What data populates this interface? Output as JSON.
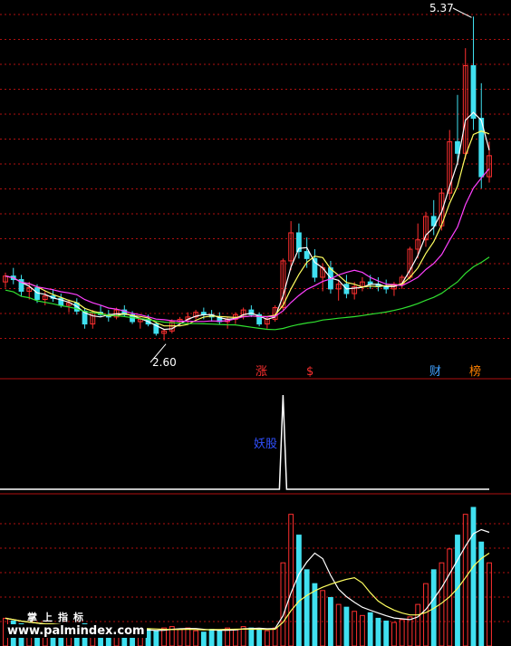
{
  "colors": {
    "background": "#000000",
    "grid": "#b01010",
    "up": "#ff3030",
    "down": "#40e0f0",
    "ma_fast": "#ffffff",
    "ma_mid": "#ffff60",
    "ma_slow": "#ff40ff",
    "ma_long": "#30e030",
    "signal_zhang": "#ff3030",
    "signal_dollar": "#ff3030",
    "signal_cai": "#40a0ff",
    "signal_bang": "#ff8000",
    "indicator_line": "#ffffff",
    "indicator_label": "#3050ff"
  },
  "annotations": {
    "high_price": "5.37",
    "low_price": "2.60"
  },
  "signals": {
    "zhang": "涨",
    "dollar": "$",
    "cai": "财",
    "bang": "榜"
  },
  "indicator": {
    "label": "妖股"
  },
  "watermark": {
    "line1": "掌上指标",
    "line2": "www.palmindex.com"
  },
  "chart_data": {
    "type": "candlestick",
    "panels": [
      "price",
      "signal",
      "volume"
    ],
    "price": {
      "ylim": [
        2.45,
        5.45
      ],
      "high": 5.37,
      "low": 2.6,
      "candles_ohlc": [
        [
          3.1,
          3.18,
          3.05,
          3.15
        ],
        [
          3.15,
          3.22,
          3.08,
          3.12
        ],
        [
          3.12,
          3.16,
          2.98,
          3.02
        ],
        [
          3.02,
          3.1,
          2.95,
          3.05
        ],
        [
          3.05,
          3.08,
          2.92,
          2.95
        ],
        [
          2.95,
          3.02,
          2.9,
          2.98
        ],
        [
          2.98,
          3.04,
          2.93,
          2.96
        ],
        [
          2.96,
          3.0,
          2.88,
          2.9
        ],
        [
          2.9,
          2.95,
          2.84,
          2.92
        ],
        [
          2.92,
          2.96,
          2.82,
          2.85
        ],
        [
          2.85,
          2.88,
          2.7,
          2.74
        ],
        [
          2.74,
          2.86,
          2.7,
          2.84
        ],
        [
          2.84,
          2.9,
          2.8,
          2.82
        ],
        [
          2.82,
          2.86,
          2.76,
          2.8
        ],
        [
          2.8,
          2.88,
          2.78,
          2.86
        ],
        [
          2.86,
          2.9,
          2.8,
          2.82
        ],
        [
          2.82,
          2.85,
          2.74,
          2.76
        ],
        [
          2.76,
          2.8,
          2.7,
          2.78
        ],
        [
          2.78,
          2.82,
          2.72,
          2.74
        ],
        [
          2.74,
          2.76,
          2.64,
          2.66
        ],
        [
          2.66,
          2.7,
          2.6,
          2.68
        ],
        [
          2.68,
          2.78,
          2.66,
          2.76
        ],
        [
          2.76,
          2.8,
          2.72,
          2.78
        ],
        [
          2.78,
          2.84,
          2.74,
          2.8
        ],
        [
          2.8,
          2.86,
          2.78,
          2.84
        ],
        [
          2.84,
          2.88,
          2.78,
          2.82
        ],
        [
          2.82,
          2.86,
          2.76,
          2.8
        ],
        [
          2.8,
          2.84,
          2.74,
          2.76
        ],
        [
          2.76,
          2.8,
          2.7,
          2.78
        ],
        [
          2.78,
          2.84,
          2.74,
          2.82
        ],
        [
          2.82,
          2.88,
          2.78,
          2.86
        ],
        [
          2.86,
          2.9,
          2.8,
          2.82
        ],
        [
          2.82,
          2.84,
          2.72,
          2.74
        ],
        [
          2.74,
          2.8,
          2.7,
          2.78
        ],
        [
          2.78,
          2.9,
          2.76,
          2.88
        ],
        [
          2.88,
          3.3,
          2.86,
          3.28
        ],
        [
          3.28,
          3.62,
          3.2,
          3.52
        ],
        [
          3.52,
          3.6,
          3.3,
          3.36
        ],
        [
          3.36,
          3.48,
          3.22,
          3.3
        ],
        [
          3.3,
          3.38,
          3.1,
          3.14
        ],
        [
          3.14,
          3.26,
          3.02,
          3.22
        ],
        [
          3.22,
          3.28,
          3.0,
          3.04
        ],
        [
          3.04,
          3.12,
          2.94,
          3.08
        ],
        [
          3.08,
          3.16,
          2.96,
          3.0
        ],
        [
          3.0,
          3.1,
          2.95,
          3.06
        ],
        [
          3.06,
          3.14,
          3.02,
          3.1
        ],
        [
          3.1,
          3.16,
          3.04,
          3.08
        ],
        [
          3.08,
          3.14,
          3.02,
          3.06
        ],
        [
          3.06,
          3.12,
          3.0,
          3.04
        ],
        [
          3.04,
          3.1,
          2.98,
          3.08
        ],
        [
          3.08,
          3.16,
          3.04,
          3.14
        ],
        [
          3.14,
          3.4,
          3.12,
          3.38
        ],
        [
          3.38,
          3.6,
          3.3,
          3.46
        ],
        [
          3.46,
          3.7,
          3.4,
          3.66
        ],
        [
          3.66,
          3.8,
          3.5,
          3.58
        ],
        [
          3.58,
          3.9,
          3.54,
          3.86
        ],
        [
          3.86,
          4.4,
          3.8,
          4.3
        ],
        [
          4.3,
          4.7,
          4.1,
          4.2
        ],
        [
          4.2,
          5.1,
          4.15,
          4.95
        ],
        [
          4.95,
          5.37,
          4.4,
          4.5
        ],
        [
          4.5,
          4.8,
          3.9,
          4.0
        ],
        [
          4.0,
          4.3,
          3.95,
          4.18
        ]
      ]
    },
    "signal": {
      "spike_index": 35,
      "label": "妖股"
    },
    "volume": {
      "values": [
        20,
        18,
        16,
        15,
        14,
        13,
        15,
        12,
        14,
        13,
        16,
        15,
        12,
        11,
        13,
        12,
        11,
        10,
        12,
        11,
        13,
        14,
        12,
        13,
        11,
        10,
        12,
        11,
        13,
        12,
        14,
        13,
        12,
        11,
        13,
        60,
        95,
        80,
        55,
        45,
        40,
        35,
        30,
        28,
        25,
        22,
        24,
        20,
        18,
        17,
        19,
        21,
        30,
        45,
        55,
        60,
        70,
        80,
        95,
        100,
        75,
        60
      ]
    }
  }
}
